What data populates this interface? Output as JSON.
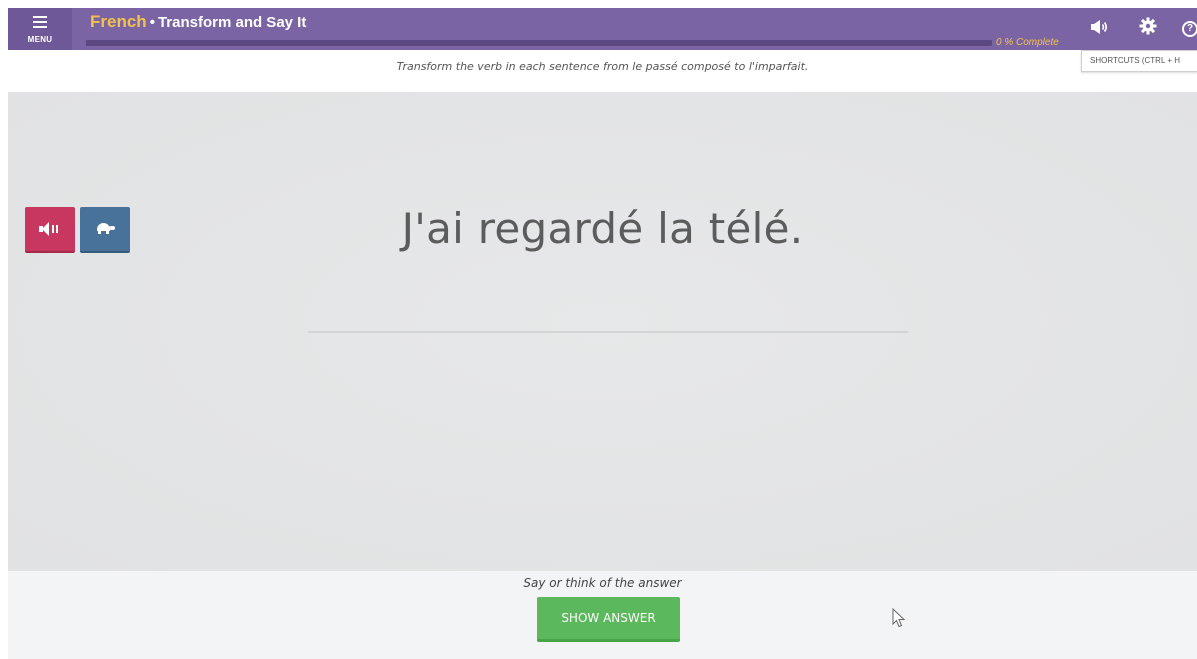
{
  "header": {
    "menu_label": "MENU",
    "language": "French",
    "separator": "•",
    "activity_title": "Transform and Say It",
    "progress_percent": 0,
    "progress_text": "0 % Complete",
    "icons": {
      "menu": "menu-icon",
      "sound": "speaker-icon",
      "settings": "gear-icon",
      "help": "help-icon"
    },
    "help_glyph": "?",
    "shortcuts_tooltip": "SHORTCUTS (CTRL + H"
  },
  "instruction": "Transform the verb in each sentence from le passé composé to l'imparfait.",
  "exercise": {
    "sentence": "J'ai regardé la télé.",
    "play_audio_icon": "speaker-icon",
    "slow_audio_icon": "turtle-icon"
  },
  "footer": {
    "prompt": "Say or think of the answer",
    "show_answer_label": "SHOW ANSWER"
  },
  "colors": {
    "header_bg": "#7b64a3",
    "language_accent": "#f3c24c",
    "play_button": "#c8375f",
    "slow_button": "#48729a",
    "show_answer_button": "#5cb85c"
  }
}
